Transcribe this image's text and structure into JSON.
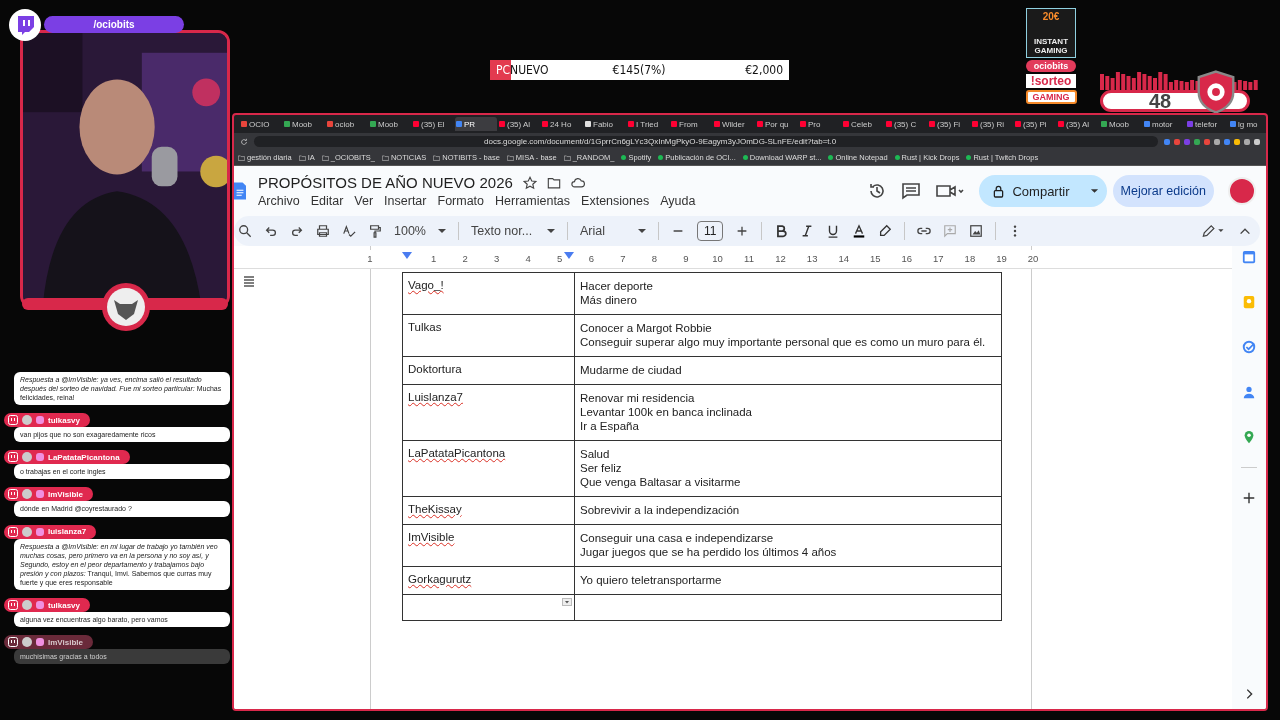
{
  "overlay": {
    "channel_name": "/ociobits",
    "goal": {
      "tag": "PC",
      "label": "NUEVO",
      "raised": "€145(7%)",
      "target": "€2,000",
      "level": 0.07
    },
    "giveaway": {
      "price": "20€",
      "brand": "INSTANT GAMING",
      "channel": "ociobits",
      "command": "!sorteo",
      "badge": "GAMING"
    },
    "viewer_count": "48"
  },
  "chat": [
    {
      "text": "*Respuesta a @ImVisible: ya ves, encima salió el resultado después del sorteo de navidad. Fue mi sorteo particular:* Muchas felicidades, reina!",
      "faded": false
    },
    {
      "user": "tulkasvy",
      "text": "van pijos que no son exagaredamente ricos",
      "faded": false
    },
    {
      "user": "LaPatataPicantona",
      "text": "o trabajas en el corte ingles",
      "faded": false
    },
    {
      "user": "ImVisible",
      "text": "dónde en Madrid @coyrestaurado ?",
      "faded": false
    },
    {
      "user": "luislanza7",
      "text": "*Respuesta a @ImVisible: en mi lugar de trabajo yo también veo muchas cosas, pero primero va en la persona y no soy así, y Segundo, estoy en el peor departamento y trabajamos bajo presión y con plazos:* Tranqui, Imvi. Sabemos que curras muy fuerte y que eres responsable",
      "faded": false
    },
    {
      "user": "tulkasvy",
      "text": "alguna vez encuentras algo barato, pero vamos",
      "faded": false
    },
    {
      "user": "ImVisible",
      "text": "muchísimas gracias a todos",
      "faded": true
    }
  ],
  "browser": {
    "tabs": [
      {
        "title": "OCIO",
        "selected": false,
        "color": "#e8453c"
      },
      {
        "title": "Moob",
        "selected": false,
        "color": "#34a853"
      },
      {
        "title": "ociob",
        "selected": false,
        "color": "#e8453c"
      },
      {
        "title": "Moob",
        "selected": false,
        "color": "#34a853"
      },
      {
        "title": "(35) El",
        "selected": false,
        "color": "#ff0033"
      },
      {
        "title": "PR",
        "selected": true,
        "color": "#4285f4"
      },
      {
        "title": "(35) Al",
        "selected": false,
        "color": "#ff0033"
      },
      {
        "title": "24 Ho",
        "selected": false,
        "color": "#ff0033"
      },
      {
        "title": "Fabio",
        "selected": false,
        "color": "#e0e0e0"
      },
      {
        "title": "I Tried",
        "selected": false,
        "color": "#ff0033"
      },
      {
        "title": "From",
        "selected": false,
        "color": "#ff0033"
      },
      {
        "title": "Wilder",
        "selected": false,
        "color": "#ff0033"
      },
      {
        "title": "Por qu",
        "selected": false,
        "color": "#ff0033"
      },
      {
        "title": "Pro",
        "selected": false,
        "color": "#ff0033"
      },
      {
        "title": "Celeb",
        "selected": false,
        "color": "#ff0033"
      },
      {
        "title": "(35) C",
        "selected": false,
        "color": "#ff0033"
      },
      {
        "title": "(35) Fi",
        "selected": false,
        "color": "#ff0033"
      },
      {
        "title": "(35) Ri",
        "selected": false,
        "color": "#ff0033"
      },
      {
        "title": "(35) Pi",
        "selected": false,
        "color": "#ff0033"
      },
      {
        "title": "(35) Al",
        "selected": false,
        "color": "#ff0033"
      },
      {
        "title": "Moob",
        "selected": false,
        "color": "#34a853"
      },
      {
        "title": "motor",
        "selected": false,
        "color": "#4285f4"
      },
      {
        "title": "telefor",
        "selected": false,
        "color": "#7b3fe4"
      },
      {
        "title": "lg mo",
        "selected": false,
        "color": "#4285f4"
      }
    ],
    "url": "docs.google.com/document/d/1GprrCn6gLYc3QxInMgPkyO-9Eagym3yJOmDG-SLnFE/edit?tab=t.0",
    "bookmarks": [
      {
        "label": "gestión diaria",
        "kind": "folder"
      },
      {
        "label": "IA",
        "kind": "folder"
      },
      {
        "label": "_OCIOBITS_",
        "kind": "folder"
      },
      {
        "label": "NOTICIAS",
        "kind": "folder"
      },
      {
        "label": "NOTIBITS - base",
        "kind": "folder"
      },
      {
        "label": "MISA - base",
        "kind": "folder"
      },
      {
        "label": "_RANDOM_",
        "kind": "folder"
      },
      {
        "label": "Spotify",
        "kind": "link"
      },
      {
        "label": "Publicación de OCI...",
        "kind": "link"
      },
      {
        "label": "Download WARP st...",
        "kind": "link"
      },
      {
        "label": "Online Notepad",
        "kind": "link"
      },
      {
        "label": "Rust | Kick Drops",
        "kind": "link"
      },
      {
        "label": "Rust | Twitch Drops",
        "kind": "link"
      }
    ]
  },
  "document": {
    "title": "PROPÓSITOS DE AÑO NUEVO 2026",
    "menu": [
      "Archivo",
      "Editar",
      "Ver",
      "Insertar",
      "Formato",
      "Herramientas",
      "Extensiones",
      "Ayuda"
    ],
    "share_button": "Compartir",
    "upgrade_button": "Mejorar edición",
    "toolbar": {
      "zoom": "100%",
      "style": "Texto nor...",
      "font": "Arial",
      "size": "11"
    },
    "ruler": [
      "1",
      "1",
      "2",
      "3",
      "4",
      "5",
      "6",
      "7",
      "8",
      "9",
      "10",
      "11",
      "12",
      "13",
      "14",
      "15",
      "16",
      "17",
      "18",
      "19",
      "20"
    ],
    "rows": [
      {
        "name": "Vago_!",
        "spellcheck": true,
        "lines": [
          "Hacer deporte",
          "Más dinero"
        ]
      },
      {
        "name": "Tulkas",
        "spellcheck": false,
        "lines": [
          "Conocer a Margot Robbie",
          "Conseguir superar algo muy importante personal que es como un muro para él."
        ]
      },
      {
        "name": "Doktortura",
        "spellcheck": false,
        "lines": [
          "Mudarme de ciudad"
        ]
      },
      {
        "name": "Luislanza7",
        "spellcheck": true,
        "lines": [
          "Renovar mi residencia",
          "Levantar 100k en banca inclinada",
          "Ir a España"
        ]
      },
      {
        "name": "LaPatataPicantona",
        "spellcheck": true,
        "lines": [
          "Salud",
          "Ser feliz",
          "Que venga Baltasar a visitarme"
        ]
      },
      {
        "name": "TheKissay",
        "spellcheck": true,
        "lines": [
          "Sobrevivir a la independización"
        ]
      },
      {
        "name": "ImVisible",
        "spellcheck": true,
        "lines": [
          "Conseguir una casa e independizarse",
          "Jugar juegos que se ha perdido los últimos 4 años"
        ]
      },
      {
        "name": "Gorkagurutz",
        "spellcheck": true,
        "lines": [
          "Yo quiero teletransportarme"
        ]
      }
    ]
  }
}
